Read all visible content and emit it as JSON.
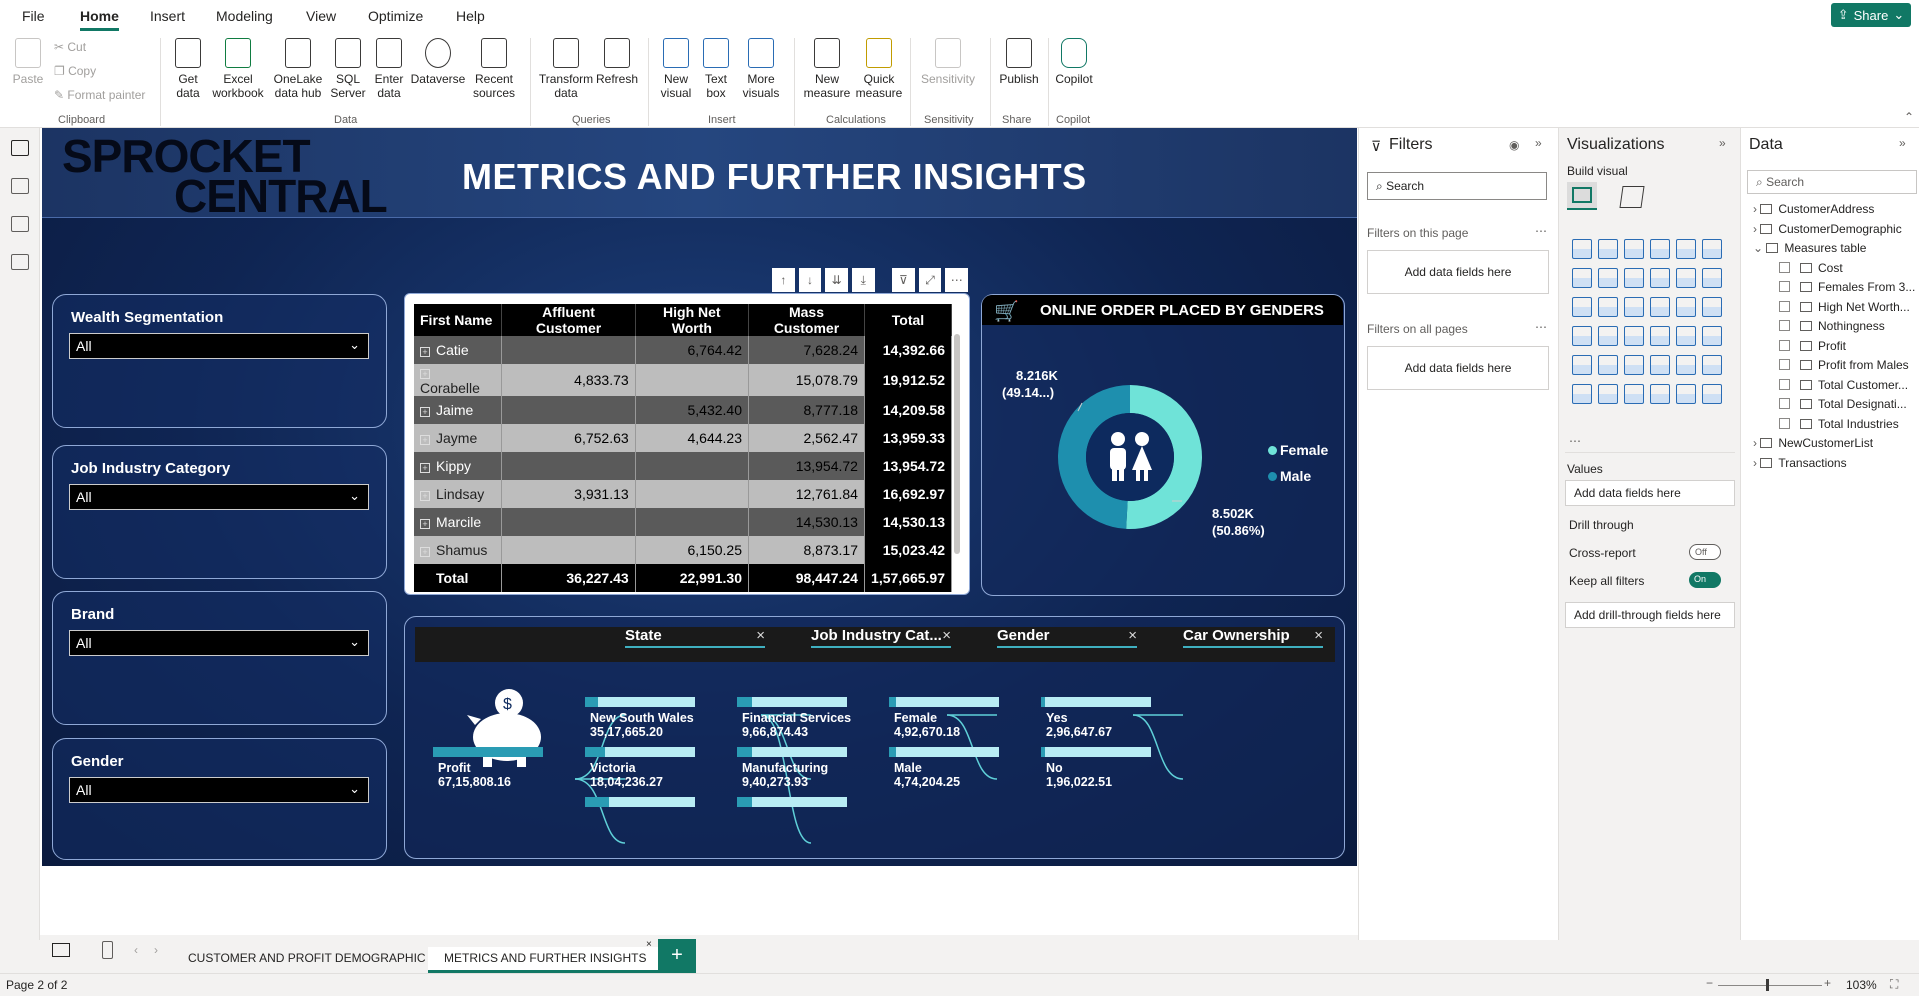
{
  "menu": {
    "file": "File",
    "home": "Home",
    "insert": "Insert",
    "modeling": "Modeling",
    "view": "View",
    "optimize": "Optimize",
    "help": "Help",
    "share": "Share"
  },
  "ribbon": {
    "clipboard": {
      "paste": "Paste",
      "cut": "Cut",
      "copy": "Copy",
      "format_painter": "Format painter",
      "label": "Clipboard"
    },
    "data": {
      "get_data": "Get data",
      "excel": "Excel workbook",
      "onelake": "OneLake data hub",
      "sql": "SQL Server",
      "enter": "Enter data",
      "dataverse": "Dataverse",
      "recent": "Recent sources",
      "label": "Data"
    },
    "queries": {
      "transform": "Transform data",
      "refresh": "Refresh",
      "label": "Queries"
    },
    "insert": {
      "new_visual": "New visual",
      "text_box": "Text box",
      "more_visuals": "More visuals",
      "label": "Insert"
    },
    "calculations": {
      "new_measure": "New measure",
      "quick_measure": "Quick measure",
      "label": "Calculations"
    },
    "sensitivity": {
      "sensitivity": "Sensitivity",
      "label": "Sensitivity"
    },
    "share": {
      "publish": "Publish",
      "label": "Share"
    },
    "copilot": {
      "copilot": "Copilot",
      "label": "Copilot"
    }
  },
  "report": {
    "logo_line1": "SPROCKET",
    "logo_line2": "CENTRAL",
    "title": "METRICS AND FURTHER INSIGHTS",
    "slicers": [
      {
        "title": "Wealth Segmentation",
        "value": "All"
      },
      {
        "title": "Job Industry Category",
        "value": "All"
      },
      {
        "title": "Brand",
        "value": "All"
      },
      {
        "title": "Gender",
        "value": "All"
      }
    ],
    "table": {
      "headers": [
        "First Name",
        "Affluent Customer",
        "High Net Worth",
        "Mass Customer",
        "Total"
      ],
      "rows": [
        [
          "Catie",
          "",
          "6,764.42",
          "7,628.24",
          "14,392.66"
        ],
        [
          "Corabelle",
          "4,833.73",
          "",
          "15,078.79",
          "19,912.52"
        ],
        [
          "Jaime",
          "",
          "5,432.40",
          "8,777.18",
          "14,209.58"
        ],
        [
          "Jayme",
          "6,752.63",
          "4,644.23",
          "2,562.47",
          "13,959.33"
        ],
        [
          "Kippy",
          "",
          "",
          "13,954.72",
          "13,954.72"
        ],
        [
          "Lindsay",
          "3,931.13",
          "",
          "12,761.84",
          "16,692.97"
        ],
        [
          "Marcile",
          "",
          "",
          "14,530.13",
          "14,530.13"
        ],
        [
          "Shamus",
          "",
          "6,150.25",
          "8,873.17",
          "15,023.42"
        ]
      ],
      "total": [
        "Total",
        "36,227.43",
        "22,991.30",
        "98,447.24",
        "1,57,665.97"
      ]
    },
    "donut": {
      "title": "ONLINE ORDER PLACED BY GENDERS",
      "female_label_value": "8.502K",
      "female_label_pct": "(50.86%)",
      "male_label_value": "8.216K",
      "male_label_pct": "(49.14...)",
      "legend_female": "Female",
      "legend_male": "Male",
      "female_color": "#6fe3d8",
      "male_color": "#1e8fae"
    },
    "tree": {
      "headers": [
        "State",
        "Job Industry Cat...",
        "Gender",
        "Car Ownership"
      ],
      "close": "×",
      "root": {
        "name": "Profit",
        "value": "67,15,808.16"
      },
      "level1": [
        {
          "name": "New South Wales",
          "value": "35,17,665.20",
          "fill": 0.12
        },
        {
          "name": "Victoria",
          "value": "18,04,236.27",
          "fill": 0.18
        },
        {
          "name": "",
          "value": "",
          "fill": 0.22
        }
      ],
      "level2": [
        {
          "name": "Financial Services",
          "value": "9,66,874.43",
          "fill": 0.14
        },
        {
          "name": "Manufacturing",
          "value": "9,40,273.93",
          "fill": 0.14
        },
        {
          "name": "",
          "value": "",
          "fill": 0.14
        }
      ],
      "level3": [
        {
          "name": "Female",
          "value": "4,92,670.18",
          "fill": 0.06
        },
        {
          "name": "Male",
          "value": "4,74,204.25",
          "fill": 0.06
        }
      ],
      "level4": [
        {
          "name": "Yes",
          "value": "2,96,647.67",
          "fill": 0.04
        },
        {
          "name": "No",
          "value": "1,96,022.51",
          "fill": 0.04
        }
      ]
    }
  },
  "filters": {
    "title": "Filters",
    "search": "Search",
    "on_page": "Filters on this page",
    "on_all": "Filters on all pages",
    "add": "Add data fields here"
  },
  "viz": {
    "title": "Visualizations",
    "build": "Build visual",
    "values": "Values",
    "add": "Add data fields here",
    "drill": "Drill through",
    "cross": "Cross-report",
    "cross_state": "Off",
    "keep": "Keep all filters",
    "keep_state": "On",
    "add_drill": "Add drill-through fields here"
  },
  "data": {
    "title": "Data",
    "search": "Search",
    "items": [
      "CustomerAddress",
      "CustomerDemographic",
      "Measures table",
      "Cost",
      "Females From 3...",
      "High Net Worth...",
      "Nothingness",
      "Profit",
      "Profit from Males",
      "Total Customer...",
      "Total Designati...",
      "Total Industries",
      "NewCustomerList",
      "Transactions"
    ]
  },
  "tabs": {
    "tab1": "CUSTOMER AND PROFIT DEMOGRAPHIC",
    "tab2": "METRICS AND FURTHER INSIGHTS",
    "add": "+"
  },
  "status": {
    "page": "Page 2 of 2",
    "zoom": "103%"
  }
}
